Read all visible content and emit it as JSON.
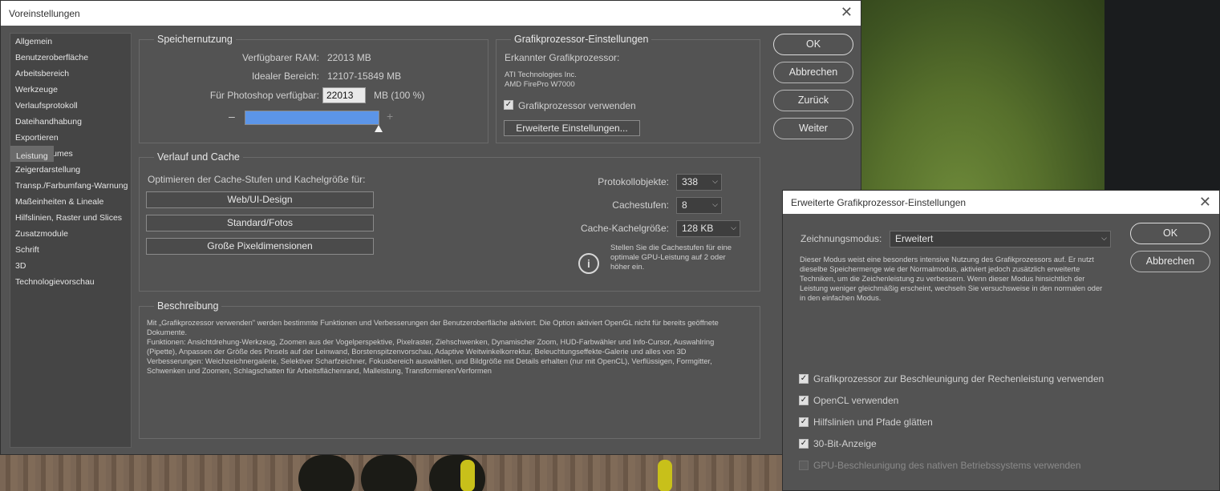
{
  "main": {
    "title": "Voreinstellungen",
    "close_icon": "close-icon",
    "nav": [
      "Allgemein",
      "Benutzeroberfläche",
      "Arbeitsbereich",
      "Werkzeuge",
      "Verlaufsprotokoll",
      "Dateihandhabung",
      "Exportieren",
      "Leistung",
      "Arbeitsvolumes",
      "Zeigerdarstellung",
      "Transp./Farbumfang-Warnung",
      "Maßeinheiten & Lineale",
      "Hilfslinien, Raster und Slices",
      "Zusatzmodule",
      "Schrift",
      "3D",
      "Technologievorschau"
    ],
    "nav_selected": "Leistung",
    "buttons": {
      "ok": "OK",
      "cancel": "Abbrechen",
      "back": "Zurück",
      "next": "Weiter"
    },
    "memory": {
      "title": "Speichernutzung",
      "ram_label": "Verfügbarer RAM:",
      "ram_value": "22013 MB",
      "ideal_label": "Idealer Bereich:",
      "ideal_value": "12107-15849 MB",
      "ps_label": "Für Photoshop verfügbar:",
      "ps_value": "22013",
      "ps_unit": "MB (100 %)",
      "minus": "–",
      "plus": "+",
      "slider_fraction": 1.0
    },
    "gpu": {
      "title": "Grafikprozessor-Einstellungen",
      "detected_label": "Erkannter Grafikprozessor:",
      "vendor": "ATI Technologies Inc.",
      "model": "AMD FirePro W7000",
      "use_label": "Grafikprozessor verwenden",
      "use_checked": true,
      "advanced_button": "Erweiterte Einstellungen..."
    },
    "cache": {
      "title": "Verlauf und Cache",
      "optimize_label": "Optimieren der Cache-Stufen und Kachelgröße für:",
      "presets": [
        "Web/UI-Design",
        "Standard/Fotos",
        "Große Pixeldimensionen"
      ],
      "history_label": "Protokollobjekte:",
      "history_value": "338",
      "levels_label": "Cachestufen:",
      "levels_value": "8",
      "tile_label": "Cache-Kachelgröße:",
      "tile_value": "128 KB",
      "info": "Stellen Sie die Cachestufen für eine optimale GPU-Leistung auf 2 oder höher ein.",
      "info_icon": "info-icon"
    },
    "description": {
      "title": "Beschreibung",
      "p1": "Mit „Grafikprozessor verwenden\" werden bestimmte Funktionen und Verbesserungen der Benutzeroberfläche aktiviert. Die Option aktiviert OpenGL nicht für bereits geöffnete Dokumente.",
      "p2": "Funktionen: Ansichtdrehung-Werkzeug, Zoomen aus der Vogelperspektive, Pixelraster, Ziehschwenken, Dynamischer Zoom, HUD-Farbwähler und Info-Cursor, Auswahlring (Pipette), Anpassen der Größe des Pinsels auf der Leinwand, Borstenspitzenvorschau, Adaptive Weitwinkelkorrektur, Beleuchtungseffekte-Galerie und alles von 3D",
      "p3": "Verbesserungen: Weichzeichnergalerie, Selektiver Scharfzeichner, Fokusbereich auswählen, und Bildgröße mit Details erhalten (nur mit OpenCL), Verflüssigen, Formgitter, Schwenken und Zoomen, Schlagschatten für Arbeitsflächenrand, Malleistung, Transformieren/Verformen"
    }
  },
  "advanced": {
    "title": "Erweiterte Grafikprozessor-Einstellungen",
    "mode_label": "Zeichnungsmodus:",
    "mode_value": "Erweitert",
    "mode_desc": "Dieser Modus weist eine besonders intensive Nutzung des Grafikprozessors auf. Er nutzt dieselbe Speichermenge wie der Normalmodus, aktiviert jedoch zusätzlich erweiterte Techniken, um die Zeichenleistung zu verbessern. Wenn dieser Modus hinsichtlich der Leistung weniger gleichmäßig erscheint, wechseln Sie versuchsweise in den normalen oder in den einfachen Modus.",
    "ok": "OK",
    "cancel": "Abbrechen",
    "options": [
      {
        "label": "Grafikprozessor zur Beschleunigung der Rechenleistung verwenden",
        "checked": true,
        "enabled": true
      },
      {
        "label": "OpenCL verwenden",
        "checked": true,
        "enabled": true
      },
      {
        "label": "Hilfslinien und Pfade glätten",
        "checked": true,
        "enabled": true
      },
      {
        "label": "30-Bit-Anzeige",
        "checked": true,
        "enabled": true
      },
      {
        "label": "GPU-Beschleunigung des nativen Betriebssystems verwenden",
        "checked": false,
        "enabled": false
      }
    ]
  }
}
